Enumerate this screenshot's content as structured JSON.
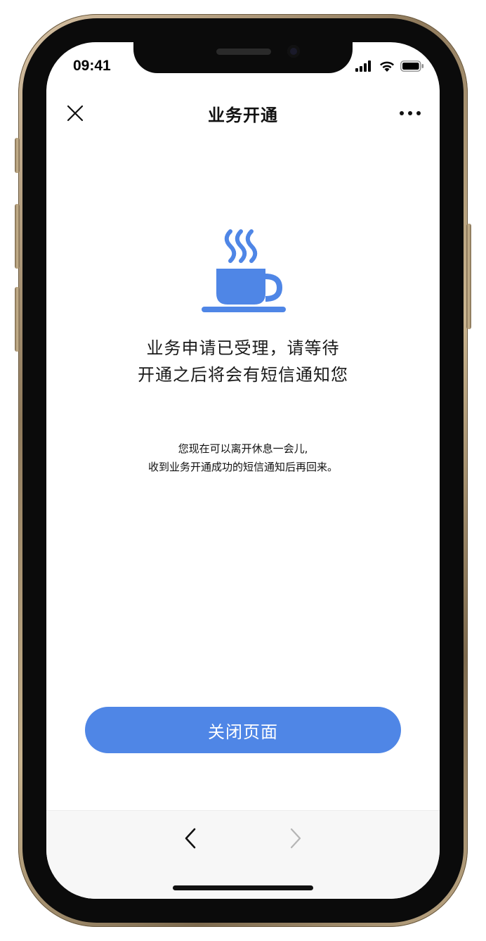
{
  "status_bar": {
    "time": "09:41",
    "icons": [
      "signal-icon",
      "wifi-icon",
      "battery-icon"
    ]
  },
  "nav": {
    "title": "业务开通",
    "close_icon": "close-icon",
    "more_icon": "more-icon"
  },
  "content": {
    "illustration": "coffee-cup-icon",
    "message_line1": "业务申请已受理，请等待",
    "message_line2": "开通之后将会有短信通知您",
    "sub_line1": "您现在可以离开休息一会儿,",
    "sub_line2": "收到业务开通成功的短信通知后再回来。"
  },
  "actions": {
    "close_page_label": "关闭页面"
  },
  "toolbar": {
    "back_icon": "chevron-left-icon",
    "forward_icon": "chevron-right-icon"
  },
  "colors": {
    "accent": "#4f86e6",
    "text": "#1a1a1a",
    "toolbar_bg": "#f7f7f7"
  }
}
